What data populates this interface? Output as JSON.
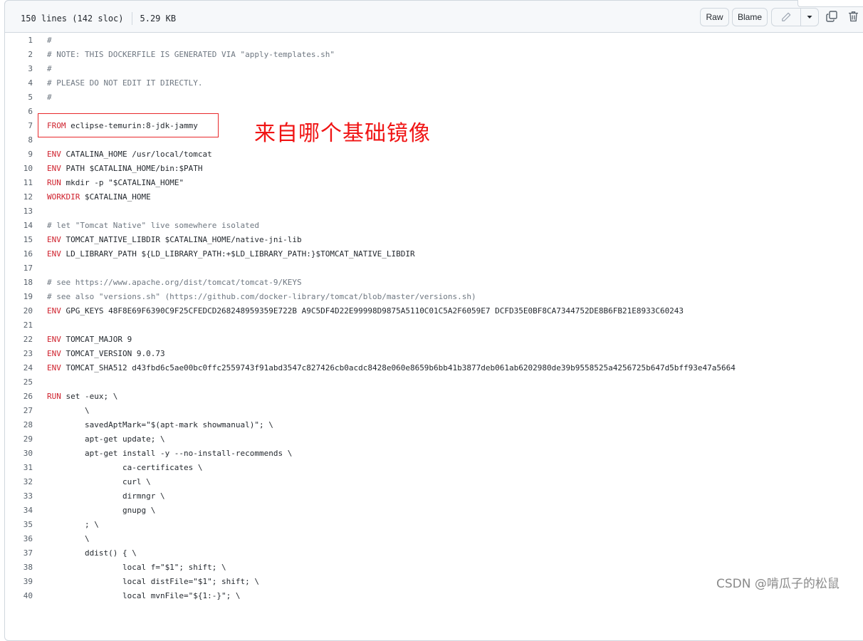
{
  "file": {
    "lines_info": "150 lines (142 sloc)",
    "size": "5.29 KB"
  },
  "toolbar": {
    "raw_label": "Raw",
    "blame_label": "Blame"
  },
  "icons": {
    "edit": "pencil-icon",
    "dropdown": "triangle-down-icon",
    "copy": "copy-icon",
    "delete": "trash-icon"
  },
  "annotation": {
    "text": "来自哪个基础镜像",
    "color": "#f01414"
  },
  "watermark": "CSDN @啃瓜子的松鼠",
  "code_lines": [
    [
      {
        "t": "#",
        "c": "cm"
      }
    ],
    [
      {
        "t": "# NOTE: THIS DOCKERFILE IS GENERATED VIA \"apply-templates.sh\"",
        "c": "cm"
      }
    ],
    [
      {
        "t": "#",
        "c": "cm"
      }
    ],
    [
      {
        "t": "# PLEASE DO NOT EDIT IT DIRECTLY.",
        "c": "cm"
      }
    ],
    [
      {
        "t": "#",
        "c": "cm"
      }
    ],
    [],
    [
      {
        "t": "FROM",
        "c": "kw"
      },
      {
        "t": " eclipse-temurin:8-jdk-jammy"
      }
    ],
    [],
    [
      {
        "t": "ENV",
        "c": "kw"
      },
      {
        "t": " CATALINA_HOME /usr/local/tomcat"
      }
    ],
    [
      {
        "t": "ENV",
        "c": "kw"
      },
      {
        "t": " PATH $CATALINA_HOME/bin:$PATH"
      }
    ],
    [
      {
        "t": "RUN",
        "c": "kw"
      },
      {
        "t": " mkdir -p \"$CATALINA_HOME\""
      }
    ],
    [
      {
        "t": "WORKDIR",
        "c": "kw"
      },
      {
        "t": " $CATALINA_HOME"
      }
    ],
    [],
    [
      {
        "t": "# let \"Tomcat Native\" live somewhere isolated",
        "c": "cm"
      }
    ],
    [
      {
        "t": "ENV",
        "c": "kw"
      },
      {
        "t": " TOMCAT_NATIVE_LIBDIR $CATALINA_HOME/native-jni-lib"
      }
    ],
    [
      {
        "t": "ENV",
        "c": "kw"
      },
      {
        "t": " LD_LIBRARY_PATH ${LD_LIBRARY_PATH:+$LD_LIBRARY_PATH:}$TOMCAT_NATIVE_LIBDIR"
      }
    ],
    [],
    [
      {
        "t": "# see https://www.apache.org/dist/tomcat/tomcat-9/KEYS",
        "c": "cm"
      }
    ],
    [
      {
        "t": "# see also \"versions.sh\" (https://github.com/docker-library/tomcat/blob/master/versions.sh)",
        "c": "cm"
      }
    ],
    [
      {
        "t": "ENV",
        "c": "kw"
      },
      {
        "t": " GPG_KEYS 48F8E69F6390C9F25CFEDCD268248959359E722B A9C5DF4D22E99998D9875A5110C01C5A2F6059E7 DCFD35E0BF8CA7344752DE8B6FB21E8933C60243"
      }
    ],
    [],
    [
      {
        "t": "ENV",
        "c": "kw"
      },
      {
        "t": " TOMCAT_MAJOR 9"
      }
    ],
    [
      {
        "t": "ENV",
        "c": "kw"
      },
      {
        "t": " TOMCAT_VERSION 9.0.73"
      }
    ],
    [
      {
        "t": "ENV",
        "c": "kw"
      },
      {
        "t": " TOMCAT_SHA512 d43fbd6c5ae00bc0ffc2559743f91abd3547c827426cb0acdc8428e060e8659b6bb41b3877deb061ab6202980de39b9558525a4256725b647d5bff93e47a5664"
      }
    ],
    [],
    [
      {
        "t": "RUN",
        "c": "kw"
      },
      {
        "t": " set -eux; \\"
      }
    ],
    [
      {
        "t": "        \\"
      }
    ],
    [
      {
        "t": "        savedAptMark=\"$(apt-mark showmanual)\"; \\"
      }
    ],
    [
      {
        "t": "        apt-get update; \\"
      }
    ],
    [
      {
        "t": "        apt-get install -y --no-install-recommends \\"
      }
    ],
    [
      {
        "t": "                ca-certificates \\"
      }
    ],
    [
      {
        "t": "                curl \\"
      }
    ],
    [
      {
        "t": "                dirmngr \\"
      }
    ],
    [
      {
        "t": "                gnupg \\"
      }
    ],
    [
      {
        "t": "        ; \\"
      }
    ],
    [
      {
        "t": "        \\"
      }
    ],
    [
      {
        "t": "        ddist() { \\"
      }
    ],
    [
      {
        "t": "                local f=\"$1\"; shift; \\"
      }
    ],
    [
      {
        "t": "                local distFile=\"$1\"; shift; \\"
      }
    ],
    [
      {
        "t": "                local mvnFile=\"${1:-}\"; \\"
      }
    ]
  ]
}
